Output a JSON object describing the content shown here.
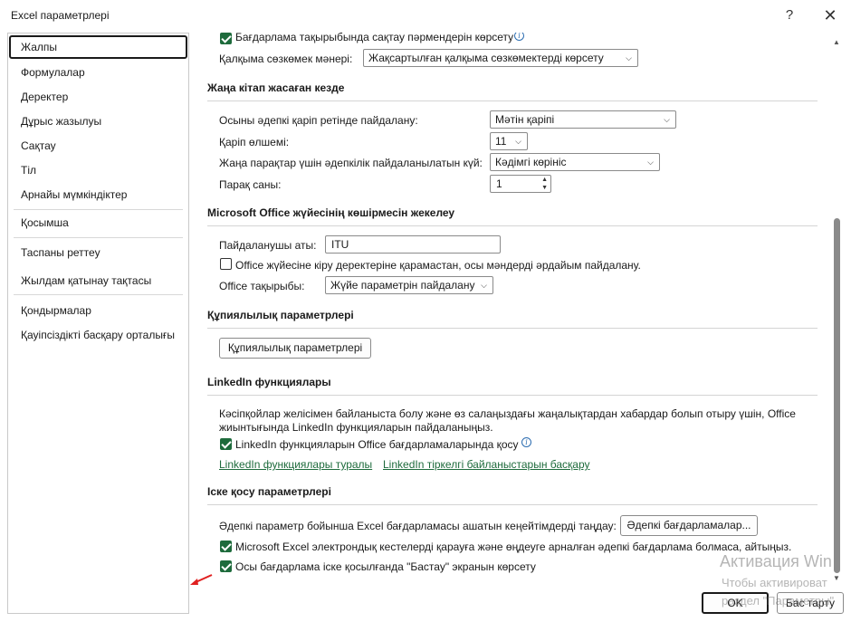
{
  "window": {
    "title": "Excel параметрлері",
    "help_icon": "?",
    "close_icon": "✕"
  },
  "sidebar": {
    "items": [
      {
        "label": "Жалпы",
        "selected": true
      },
      {
        "label": "Формулалар"
      },
      {
        "label": "Деректер"
      },
      {
        "label": "Дұрыс жазылуы"
      },
      {
        "label": "Сақтау"
      },
      {
        "label": "Тіл"
      },
      {
        "label": "Арнайы мүмкіндіктер"
      },
      {
        "label": "Қосымша"
      },
      {
        "label": "Таспаны реттеу"
      },
      {
        "label": "Жылдам қатынау тақтасы"
      },
      {
        "label": "Қондырмалар"
      },
      {
        "label": "Қауіпсіздікті басқару орталығы"
      }
    ]
  },
  "ui_options": {
    "show_feature_names_label": "Бағдарлама тақырыбында сақтау пәрмендерін көрсету",
    "show_feature_names_checked": true,
    "tooltip_style_label": "Қалқыма сөзкөмек мәнері:",
    "tooltip_style_value": "Жақсартылған қалқыма сөзкөмектерді көрсету"
  },
  "new_workbook": {
    "title": "Жаңа кітап жасаған кезде",
    "font_label": "Осыны әдепкі қаріп ретінде пайдалану:",
    "font_value": "Мәтін қаріпі",
    "size_label": "Қаріп өлшемі:",
    "size_value": "11",
    "view_label": "Жаңа парақтар үшін әдепкілік пайдаланылатын күй:",
    "view_value": "Кәдімгі көрініс",
    "sheets_label": "Парақ саны:",
    "sheets_value": "1"
  },
  "personalize": {
    "title": "Microsoft Office жүйесінің көшірмесін жекелеу",
    "username_label": "Пайдаланушы аты:",
    "username_value": "ITU",
    "always_use_label": "Office жүйесіне кіру деректеріне қарамастан, осы мәндерді әрдайым пайдалану.",
    "always_use_checked": false,
    "theme_label": "Office тақырыбы:",
    "theme_value": "Жүйе параметрін пайдалану"
  },
  "privacy": {
    "title": "Құпиялылық параметрлері",
    "button_label": "Құпиялылық параметрлері"
  },
  "linkedin": {
    "title": "LinkedIn функциялары",
    "description_line1": "Кәсіпқойлар желісімен байланыста болу және өз салаңыздағы жаңалықтардан хабардар болып отыру үшін, Office",
    "description_line2": "жиынтығында LinkedIn функцияларын пайдаланыңыз.",
    "enable_label": "LinkedIn функцияларын Office бағдарламаларында қосу",
    "enable_checked": true,
    "link_about": "LinkedIn функциялары туралы",
    "link_manage": "LinkedIn тіркелгі байланыстарын басқару"
  },
  "startup": {
    "title": "Іске қосу параметрлері",
    "default_programs_label": "Әдепкі параметр бойынша Excel бағдарламасы ашатын кеңейтімдерді таңдау:",
    "default_programs_button": "Әдепкі бағдарламалар...",
    "tell_me_label": "Microsoft Excel электрондық кестелерді қарауға және өңдеуге арналған әдепкі бағдарлама болмаса, айтыңыз.",
    "tell_me_checked": true,
    "show_start_label": "Осы бағдарлама іске қосылғанда \"Бастау\" экранын көрсету",
    "show_start_checked": true
  },
  "footer": {
    "ok_label": "OK",
    "cancel_label": "Бас тарту"
  },
  "watermark": {
    "line1": "Активация Win",
    "line2": "Чтобы активироват",
    "line3": "раздел \"Параметры\""
  },
  "colors": {
    "accent_green": "#1e6b3c",
    "arrow_red": "#e02020"
  }
}
